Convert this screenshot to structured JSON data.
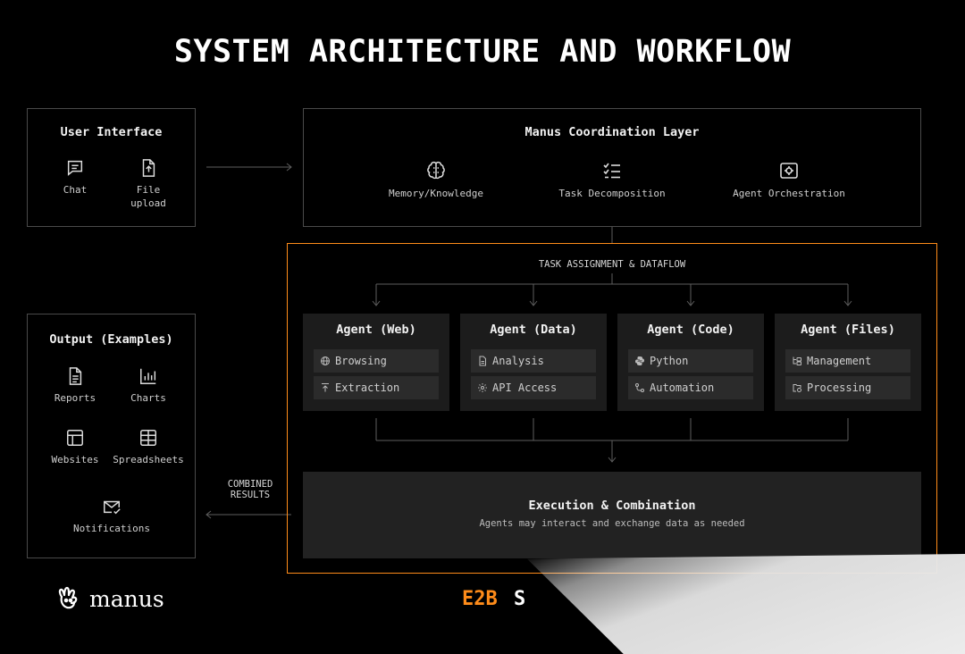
{
  "title": "SYSTEM ARCHITECTURE AND WORKFLOW",
  "user_interface": {
    "title": "User Interface",
    "items": [
      {
        "label_line1": "Chat",
        "label_line2": "",
        "icon": "chat-icon"
      },
      {
        "label_line1": "File",
        "label_line2": "upload",
        "icon": "file-upload-icon"
      }
    ]
  },
  "coordination": {
    "title": "Manus Coordination Layer",
    "items": [
      {
        "label": "Memory/Knowledge",
        "icon": "brain-icon"
      },
      {
        "label": "Task Decomposition",
        "icon": "checklist-icon"
      },
      {
        "label": "Agent Orchestration",
        "icon": "orchestration-icon"
      }
    ]
  },
  "dataflow_label": "TASK ASSIGNMENT & DATAFLOW",
  "agents": [
    {
      "title": "Agent (Web)",
      "rows": [
        {
          "label": "Browsing",
          "icon": "globe-icon"
        },
        {
          "label": "Extraction",
          "icon": "extract-icon"
        }
      ]
    },
    {
      "title": "Agent (Data)",
      "rows": [
        {
          "label": "Analysis",
          "icon": "document-icon"
        },
        {
          "label": "API Access",
          "icon": "gear-icon"
        }
      ]
    },
    {
      "title": "Agent (Code)",
      "rows": [
        {
          "label": "Python",
          "icon": "python-icon"
        },
        {
          "label": "Automation",
          "icon": "workflow-icon"
        }
      ]
    },
    {
      "title": "Agent (Files)",
      "rows": [
        {
          "label": "Management",
          "icon": "folder-tree-icon"
        },
        {
          "label": "Processing",
          "icon": "folder-sync-icon"
        }
      ]
    }
  ],
  "execution": {
    "title": "Execution & Combination",
    "subtitle": "Agents may interact and exchange data as needed"
  },
  "combined_results": {
    "line1": "COMBINED",
    "line2": "RESULTS"
  },
  "output": {
    "title": "Output (Examples)",
    "items": [
      {
        "label": "Reports",
        "icon": "report-icon"
      },
      {
        "label": "Charts",
        "icon": "bar-chart-icon"
      },
      {
        "label": "Websites",
        "icon": "website-icon"
      },
      {
        "label": "Spreadsheets",
        "icon": "spreadsheet-icon"
      },
      {
        "label": "Notifications",
        "icon": "mail-check-icon"
      }
    ]
  },
  "footer": {
    "brand": "manus",
    "e2b": "E2B",
    "e2b_suffix": "S"
  },
  "colors": {
    "accent": "#ff8c1a",
    "border": "#4a4a4a",
    "card": "#1c1c1c",
    "row": "#2b2b2b",
    "background": "#000000"
  }
}
